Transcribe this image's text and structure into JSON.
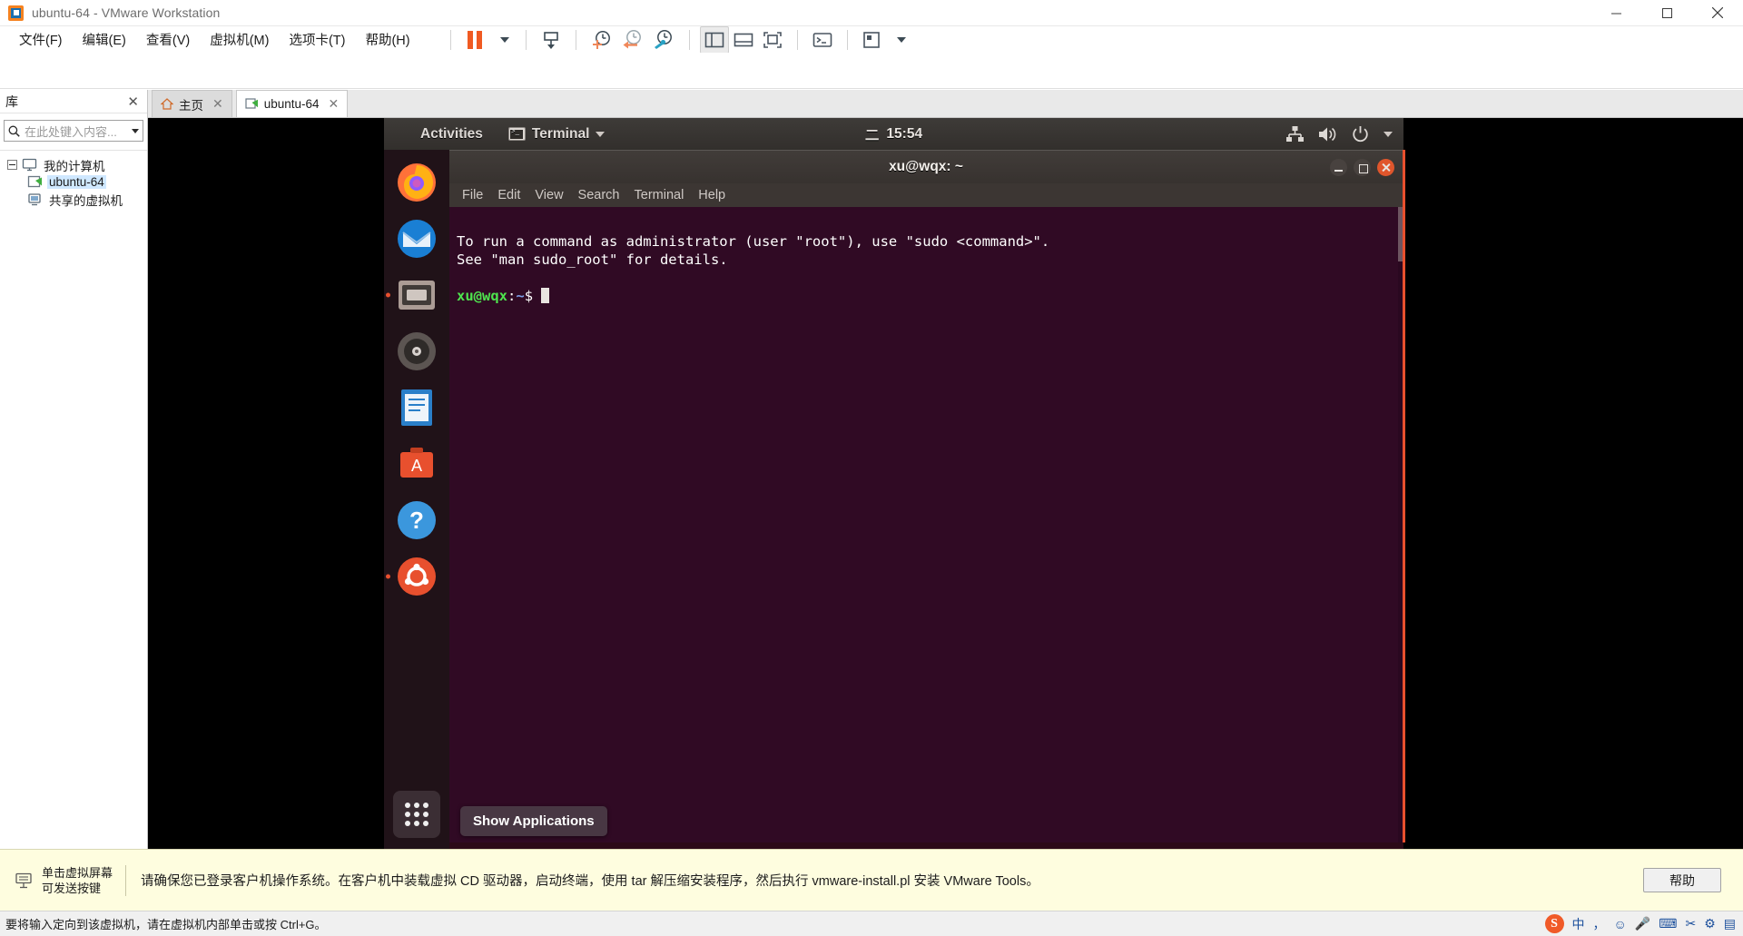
{
  "window": {
    "title": "ubuntu-64 - VMware Workstation",
    "logo_icon": "vmware-logo-icon",
    "minimize_icon": "minimize-icon",
    "maximize_icon": "maximize-icon",
    "close_icon": "close-icon"
  },
  "menubar": {
    "items": [
      {
        "label": "文件(F)",
        "name": "menu-file"
      },
      {
        "label": "编辑(E)",
        "name": "menu-edit"
      },
      {
        "label": "查看(V)",
        "name": "menu-view"
      },
      {
        "label": "虚拟机(M)",
        "name": "menu-vm"
      },
      {
        "label": "选项卡(T)",
        "name": "menu-tabs"
      },
      {
        "label": "帮助(H)",
        "name": "menu-help"
      }
    ]
  },
  "toolbar": {
    "buttons": [
      {
        "name": "suspend-button",
        "icon": "pause-icon"
      },
      {
        "name": "power-dropdown-button",
        "icon": "chevron-down-icon"
      },
      {
        "name": "send-ctrl-alt-del-button",
        "icon": "keyboard-send-icon"
      },
      {
        "name": "take-snapshot-button",
        "icon": "snapshot-add-icon"
      },
      {
        "name": "revert-snapshot-button",
        "icon": "snapshot-revert-icon"
      },
      {
        "name": "manage-snapshots-button",
        "icon": "snapshot-manager-icon"
      },
      {
        "name": "show-library-button",
        "icon": "sidebar-panel-icon"
      },
      {
        "name": "show-console-view-button",
        "icon": "bottom-panel-icon"
      },
      {
        "name": "fullscreen-button",
        "icon": "fullscreen-icon"
      },
      {
        "name": "unity-mode-button",
        "icon": "unity-icon"
      },
      {
        "name": "console-button",
        "icon": "terminal-icon"
      },
      {
        "name": "preferences-button",
        "icon": "preferences-icon"
      },
      {
        "name": "preferences-dropdown",
        "icon": "chevron-down-icon"
      }
    ]
  },
  "library": {
    "header": "库",
    "close_icon": "close-icon",
    "search": {
      "placeholder": "在此处键入内容...",
      "value": "",
      "icon": "search-icon",
      "dropdown_icon": "chevron-down-icon"
    },
    "tree": [
      {
        "label": "我的计算机",
        "name": "tree-item-my-computer",
        "level": 1,
        "icon": "computer-icon",
        "expanded": true,
        "selected": false
      },
      {
        "label": "ubuntu-64",
        "name": "tree-item-ubuntu-64",
        "level": 2,
        "icon": "vm-icon",
        "selected": true
      },
      {
        "label": "共享的虚拟机",
        "name": "tree-item-shared-vms",
        "level": 2,
        "icon": "shared-vm-icon",
        "selected": false
      }
    ]
  },
  "tabs": [
    {
      "label": "主页",
      "name": "tab-home",
      "icon": "home-icon",
      "active": false,
      "close_icon": "close-icon"
    },
    {
      "label": "ubuntu-64",
      "name": "tab-ubuntu-64",
      "icon": "vm-icon",
      "active": true,
      "close_icon": "close-icon"
    }
  ],
  "guest": {
    "topbar": {
      "activities": "Activities",
      "app_menu_label": "Terminal",
      "app_menu_icon": "terminal-icon",
      "app_menu_caret": "chevron-down-icon",
      "clock_day": "二",
      "clock_time": "15:54",
      "tray": [
        {
          "name": "network-icon",
          "icon": "network-icon"
        },
        {
          "name": "volume-icon",
          "icon": "volume-icon"
        },
        {
          "name": "power-icon",
          "icon": "power-icon"
        },
        {
          "name": "system-menu-caret",
          "icon": "chevron-down-icon"
        }
      ]
    },
    "dock": [
      {
        "name": "dock-item-firefox",
        "icon": "firefox-icon",
        "running": false
      },
      {
        "name": "dock-item-thunderbird",
        "icon": "thunderbird-icon",
        "running": false
      },
      {
        "name": "dock-item-files",
        "icon": "files-icon",
        "running": true
      },
      {
        "name": "dock-item-rhythmbox",
        "icon": "rhythmbox-icon",
        "running": false
      },
      {
        "name": "dock-item-libreoffice-writer",
        "icon": "libreoffice-writer-icon",
        "running": false
      },
      {
        "name": "dock-item-ubuntu-software",
        "icon": "ubuntu-software-icon",
        "running": false
      },
      {
        "name": "dock-item-help",
        "icon": "help-icon",
        "running": false
      },
      {
        "name": "dock-item-amazon",
        "icon": "ubuntu-icon",
        "running": true
      }
    ],
    "show_applications_tooltip": "Show Applications",
    "terminal": {
      "title": "xu@wqx: ~",
      "menu": [
        "File",
        "Edit",
        "View",
        "Search",
        "Terminal",
        "Help"
      ],
      "lines": [
        "To run a command as administrator (user \"root\"), use \"sudo <command>\".",
        "See \"man sudo_root\" for details.",
        ""
      ],
      "prompt_user": "xu@wqx",
      "prompt_sep": ":",
      "prompt_path": "~",
      "prompt_char": "$ ",
      "window_buttons": {
        "minimize": "minimize-icon",
        "maximize": "maximize-icon",
        "close": "close-icon"
      }
    }
  },
  "hintbar": {
    "icon": "keyboard-icon",
    "key_hint_line1": "单击虚拟屏幕",
    "key_hint_line2": "可发送按键",
    "message": "请确保您已登录客户机操作系统。在客户机中装载虚拟 CD 驱动器，启动终端，使用 tar 解压缩安装程序，然后执行 vmware-install.pl 安装 VMware Tools。",
    "help_button": "帮助"
  },
  "statusbar": {
    "text": "要将输入定向到该虚拟机，请在虚拟机内部单击或按 Ctrl+G。",
    "tray": [
      {
        "name": "sogou-ime-icon",
        "label": "S"
      },
      {
        "name": "ime-chinese-mode",
        "label": "中"
      },
      {
        "name": "ime-punctuation-mode",
        "label": "，"
      },
      {
        "name": "ime-emoji-icon",
        "label": "☺"
      },
      {
        "name": "ime-voice-icon",
        "label": "🎤"
      },
      {
        "name": "ime-keyboard-icon",
        "label": "⌨"
      },
      {
        "name": "ime-toolbox-icon",
        "label": "✂"
      },
      {
        "name": "ime-settings-icon",
        "label": "⚙"
      },
      {
        "name": "ime-menu-icon",
        "label": "▤"
      }
    ]
  },
  "colors": {
    "accent_orange": "#f05a22",
    "terminal_bg": "#300a24",
    "hint_bg": "#fefddf",
    "guest_panel": "#3e3b38"
  }
}
